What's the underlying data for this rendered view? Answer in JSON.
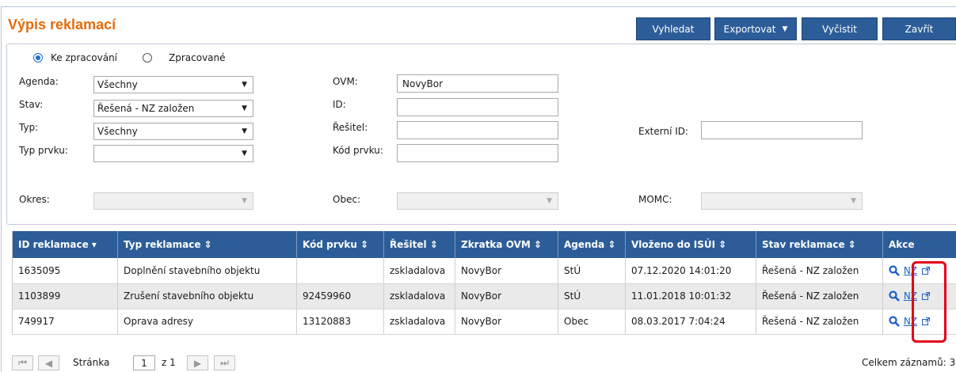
{
  "header": {
    "title": "Výpis reklamací",
    "buttons": {
      "search": "Vyhledat",
      "export": "Exportovat",
      "clear": "Vyčistit",
      "close": "Zavřít"
    }
  },
  "filters": {
    "radio": {
      "option1": "Ke zpracování",
      "option2": "Zpracované",
      "selected": "Ke zpracování"
    },
    "agenda": {
      "label": "Agenda:",
      "value": "Všechny"
    },
    "stav": {
      "label": "Stav:",
      "value": "Řešená - NZ založen"
    },
    "typ": {
      "label": "Typ:",
      "value": "Všechny"
    },
    "typ_prvku": {
      "label": "Typ prvku:",
      "value": ""
    },
    "okres": {
      "label": "Okres:",
      "value": ""
    },
    "ovm": {
      "label": "OVM:",
      "value": "NovyBor"
    },
    "id": {
      "label": "ID:",
      "value": ""
    },
    "resitel": {
      "label": "Řešitel:",
      "value": ""
    },
    "kod_prvku": {
      "label": "Kód prvku:",
      "value": ""
    },
    "obec": {
      "label": "Obec:",
      "value": ""
    },
    "externi_id": {
      "label": "Externí ID:",
      "value": ""
    },
    "momc": {
      "label": "MOMC:",
      "value": ""
    }
  },
  "table": {
    "columns": [
      "ID reklamace",
      "Typ reklamace",
      "Kód prvku",
      "Řešitel",
      "Zkratka OVM",
      "Agenda",
      "Vloženo do ISÚI",
      "Stav reklamace",
      "Akce"
    ],
    "rows": [
      {
        "id": "1635095",
        "typ": "Doplnění stavebního objektu",
        "kod": "",
        "resitel": "zskladalova",
        "ovm": "NovyBor",
        "agenda": "StÚ",
        "vlozeno": "07.12.2020 14:01:20",
        "stav": "Řešená - NZ založen",
        "akce_link": "NZ"
      },
      {
        "id": "1103899",
        "typ": "Zrušení stavebního objektu",
        "kod": "92459960",
        "resitel": "zskladalova",
        "ovm": "NovyBor",
        "agenda": "StÚ",
        "vlozeno": "11.01.2018 10:01:32",
        "stav": "Řešená - NZ založen",
        "akce_link": "NZ"
      },
      {
        "id": "749917",
        "typ": "Oprava adresy",
        "kod": "13120883",
        "resitel": "zskladalova",
        "ovm": "NovyBor",
        "agenda": "Obec",
        "vlozeno": "08.03.2017 7:04:24",
        "stav": "Řešená - NZ založen",
        "akce_link": "NZ"
      }
    ]
  },
  "pager": {
    "page_label": "Stránka",
    "page_value": "1",
    "of_label": "z 1",
    "total_label": "Celkem záznamů: 3"
  },
  "colors": {
    "title": "#e46c0a",
    "header_blue": "#2c5d98",
    "highlight_red": "#e1001a",
    "link_blue": "#1f5ec8"
  },
  "icons": {
    "sort_desc": "sort-desc-icon",
    "sort_both": "sort-both-icon",
    "search": "search-icon",
    "external": "external-link-icon",
    "first": "first-page-icon",
    "prev": "prev-page-icon",
    "next": "next-page-icon",
    "last": "last-page-icon"
  }
}
